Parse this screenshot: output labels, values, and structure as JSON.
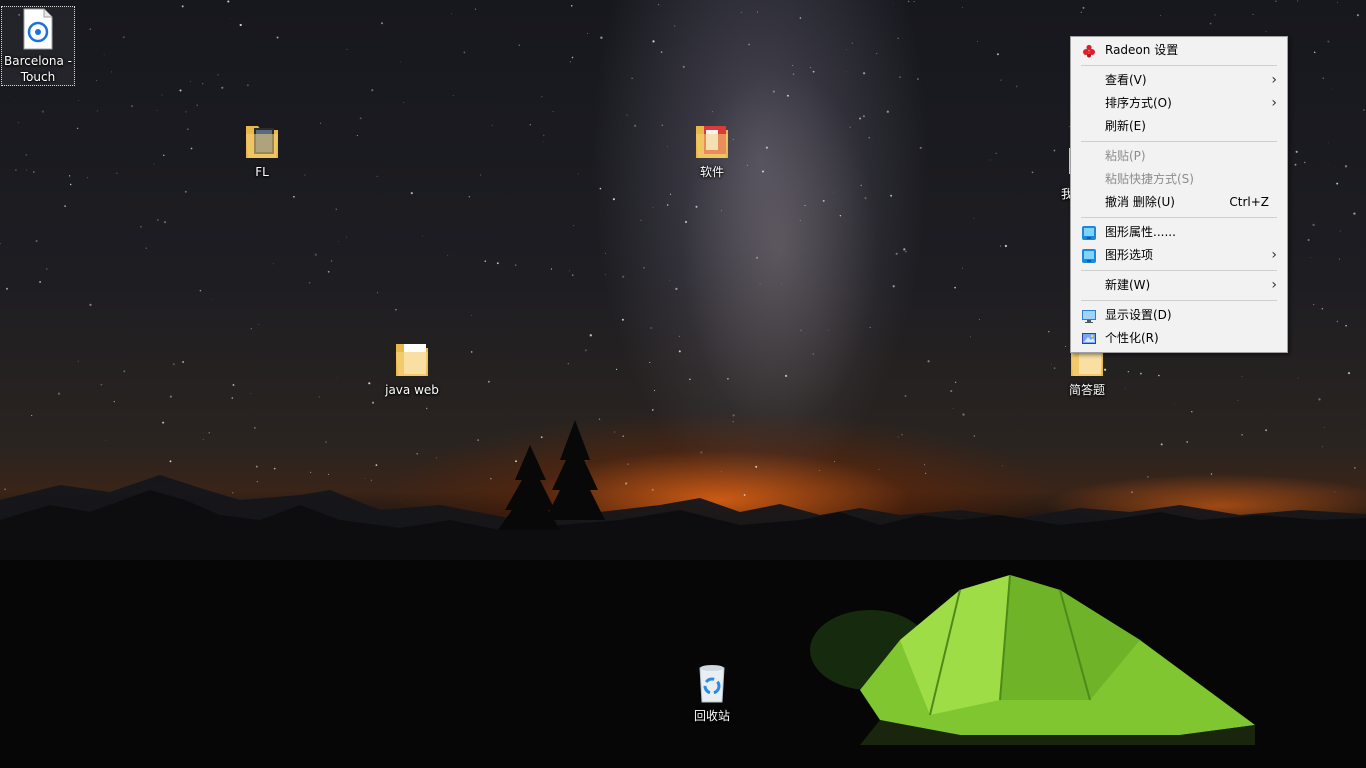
{
  "desktop_icons": {
    "barcelona": {
      "label": "Barcelona - Touch",
      "icon": "document-app-icon"
    },
    "fl": {
      "label": "FL",
      "icon": "folder-icon"
    },
    "software": {
      "label": "软件",
      "icon": "folder-icon"
    },
    "java_web": {
      "label": "java web",
      "icon": "folder-icon"
    },
    "short_answer": {
      "label": "简答题",
      "icon": "folder-icon"
    },
    "partial_icon": {
      "label": "我",
      "icon": "app-icon"
    },
    "recycle_bin": {
      "label": "回收站",
      "icon": "recycle-bin-icon"
    }
  },
  "context_menu": {
    "radeon": "Radeon 设置",
    "view": "查看(V)",
    "sort": "排序方式(O)",
    "refresh": "刷新(E)",
    "paste": "粘贴(P)",
    "paste_shortcut": "粘贴快捷方式(S)",
    "undo_delete": "撤消 删除(U)",
    "undo_shortcut": "Ctrl+Z",
    "graphics_props": "图形属性......",
    "graphics_options": "图形选项",
    "new": "新建(W)",
    "display_settings": "显示设置(D)",
    "personalize": "个性化(R)"
  },
  "colors": {
    "menu_bg": "#f2f2f2",
    "menu_disabled": "#8d8d8d",
    "radeon_red": "#e01e2b",
    "tent_green": "#8fd33a",
    "horizon_orange": "#ff6e14"
  }
}
